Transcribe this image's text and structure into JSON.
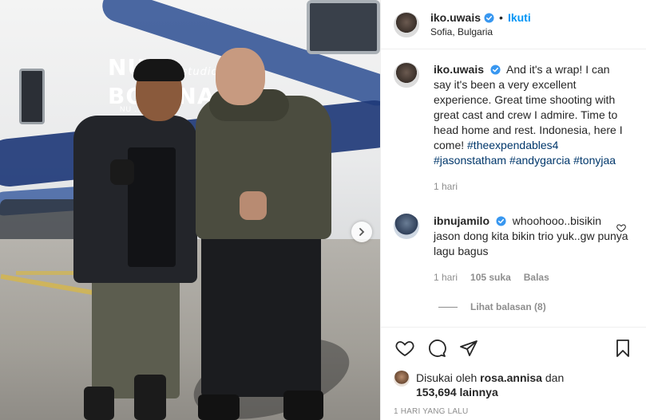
{
  "post": {
    "username": "iko.uwais",
    "follow_label": "Ikuti",
    "separator": "•",
    "location": "Sofia, Bulgaria",
    "bus_logo_line1": "NU",
    "bus_logo_studios": "film studios",
    "bus_logo_line2": "BOYANA",
    "bus_phone": "NU ... 9332500"
  },
  "caption": {
    "username": "iko.uwais",
    "text": "And it's a wrap! I can say it's been a very excellent experience. Great time shooting with great cast and crew I admire. Time to head home and rest. Indonesia, here I come!",
    "hashtags": "#theexpendables4 #jasonstatham #andygarcia #tonyjaa",
    "time": "1 hari"
  },
  "comment": {
    "username": "ibnujamilo",
    "text": "whoohooo..bisikin jason dong kita bikin trio yuk..gw punya lagu bagus",
    "time": "1 hari",
    "likes": "105 suka",
    "reply_label": "Balas",
    "view_replies": "Lihat balasan (8)"
  },
  "likes": {
    "prefix": "Disukai oleh",
    "liker": "rosa.annisa",
    "conjunction": "dan",
    "others": "153,694 lainnya"
  },
  "posted_ago": "1 HARI YANG LALU",
  "colors": {
    "link_blue": "#0095f6",
    "hashtag": "#00376b",
    "meta_gray": "#8e8e8e",
    "verified_blue": "#3897f0"
  },
  "icons": [
    "verified-icon",
    "heart-icon",
    "comment-icon",
    "share-icon",
    "save-icon",
    "chevron-right-icon"
  ]
}
